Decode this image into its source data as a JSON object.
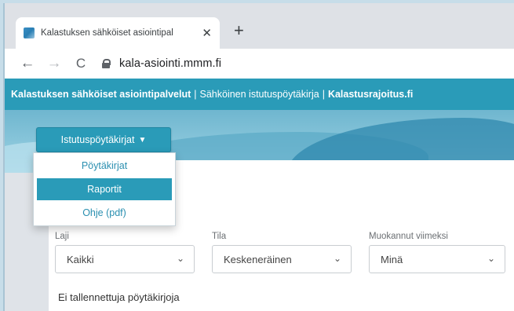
{
  "browser": {
    "tab_title": "Kalastuksen sähköiset asiointipal",
    "tab_close": "✕",
    "new_tab": "+",
    "url": "kala-asiointi.mmm.fi"
  },
  "site_header": {
    "part1": "Kalastuksen sähköiset asiointipalvelut",
    "sep1": "|",
    "part2": "Sähköinen istutuspöytäkirja",
    "sep2": "|",
    "part3": "Kalastusrajoitus.fi"
  },
  "menu": {
    "button_label": "Istutuspöytäkirjat",
    "items": [
      {
        "label": "Pöytäkirjat",
        "active": false
      },
      {
        "label": "Raportit",
        "active": true
      },
      {
        "label": "Ohje (pdf)",
        "active": false
      }
    ]
  },
  "filters": {
    "laji": {
      "label": "Laji",
      "value": "Kaikki"
    },
    "tila": {
      "label": "Tila",
      "value": "Keskeneräinen"
    },
    "muokannut": {
      "label": "Muokannut viimeksi",
      "value": "Minä"
    }
  },
  "status_text": "Ei tallennettuja pöytäkirjoja",
  "colors": {
    "accent": "#2a9bb8",
    "link": "#2a8fb0"
  }
}
